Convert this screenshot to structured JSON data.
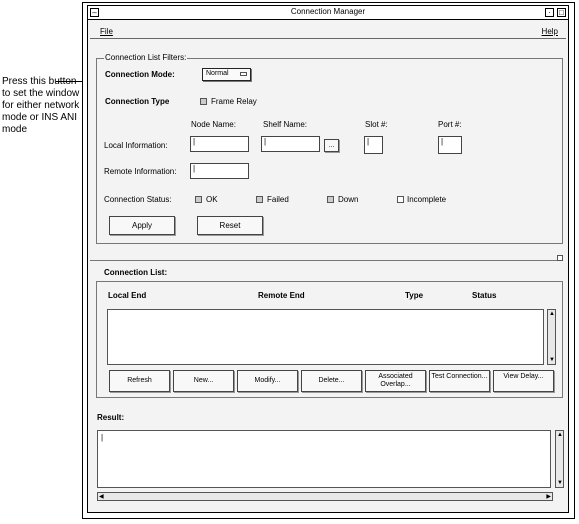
{
  "annotation": {
    "text": "Press this button to set the window for either network mode or INS ANI mode"
  },
  "window": {
    "title": "Connection Manager",
    "menu": {
      "file": "File",
      "help": "Help"
    }
  },
  "filters": {
    "group_label": "Connection List Filters:",
    "connection_mode_label": "Connection Mode:",
    "connection_mode_value": "Normal",
    "connection_type_label": "Connection Type",
    "frame_relay_label": "Frame Relay",
    "node_name_label": "Node Name:",
    "shelf_name_label": "Shelf Name:",
    "slot_label": "Slot #:",
    "port_label": "Port #:",
    "local_info_label": "Local Information:",
    "remote_info_label": "Remote Information:",
    "status_label": "Connection Status:",
    "status_ok": "OK",
    "status_failed": "Failed",
    "status_down": "Down",
    "status_incomplete": "Incomplete",
    "apply_button": "Apply",
    "reset_button": "Reset",
    "ellipsis_button": "..."
  },
  "connection_list": {
    "label": "Connection List:",
    "columns": [
      "Local End",
      "Remote End",
      "Type",
      "Status"
    ],
    "buttons": [
      "Refresh",
      "New...",
      "Modify...",
      "Delete...",
      "Associated Overlap...",
      "Test Connection...",
      "View Delay..."
    ]
  },
  "result": {
    "label": "Result:"
  }
}
